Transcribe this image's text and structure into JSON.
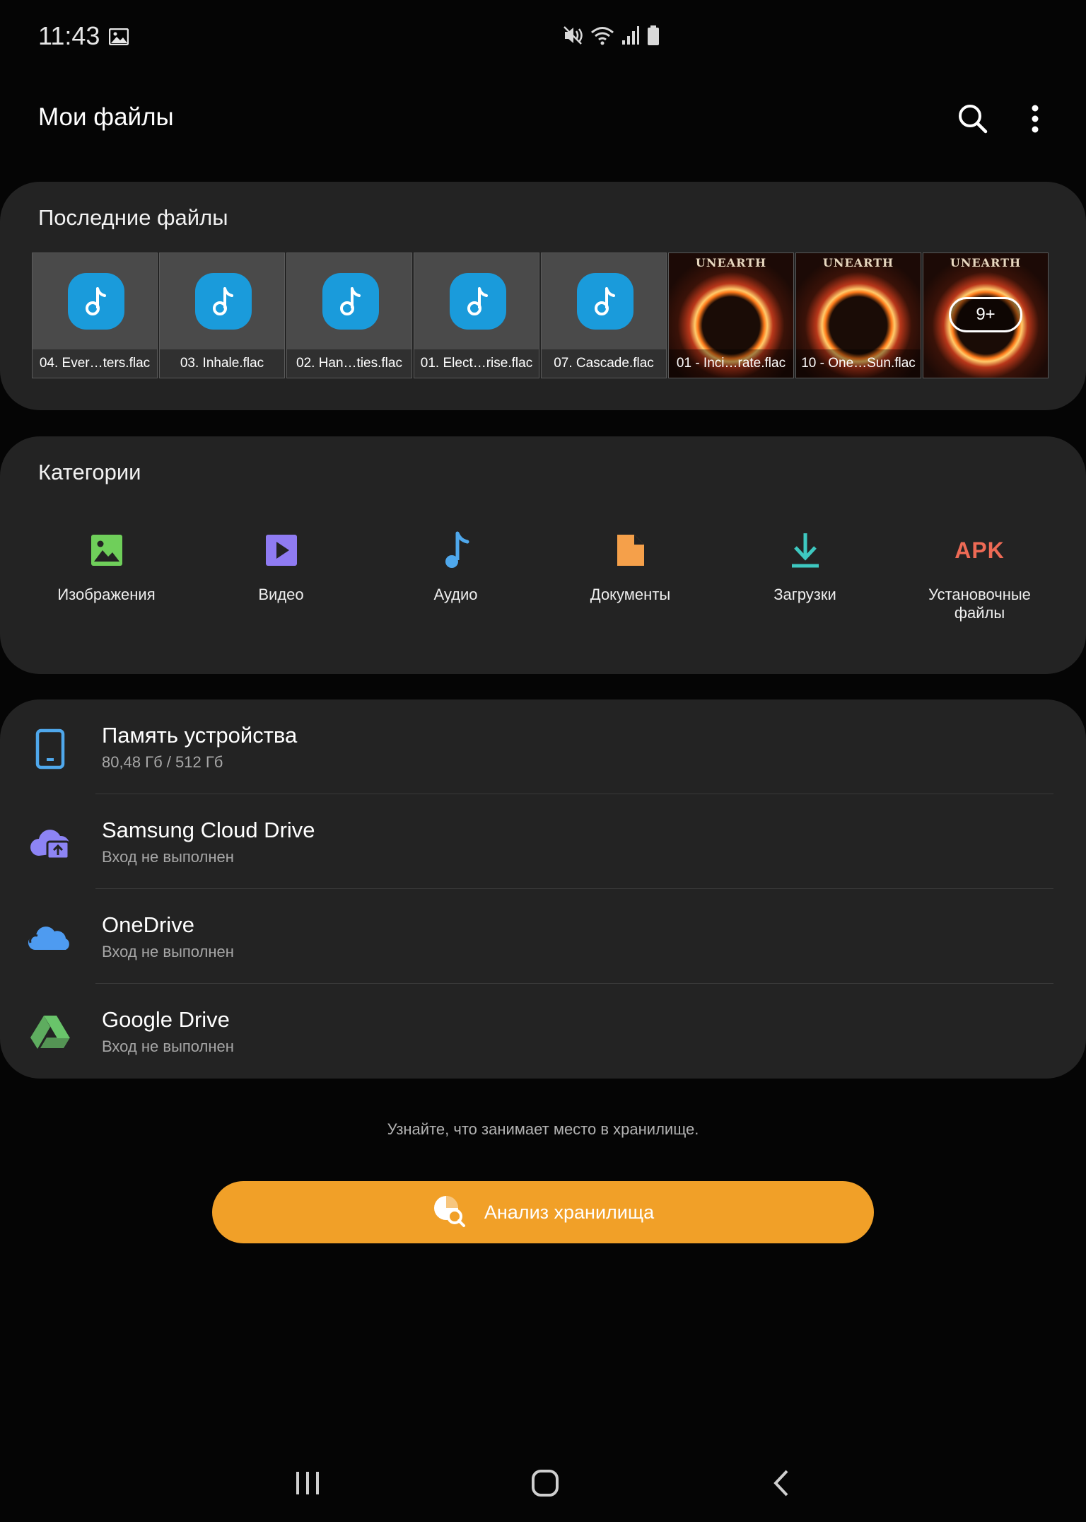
{
  "status_bar": {
    "time": "11:43",
    "icons": [
      "image-icon",
      "mute-icon",
      "wifi-icon",
      "signal-icon",
      "battery-icon"
    ]
  },
  "header": {
    "title": "Мои файлы",
    "actions": [
      "search-icon",
      "more-options-icon"
    ]
  },
  "recent": {
    "title": "Последние файлы",
    "files": [
      {
        "label": "04. Ever…ters.flac",
        "kind": "audio"
      },
      {
        "label": "03. Inhale.flac",
        "kind": "audio"
      },
      {
        "label": "02. Han…ties.flac",
        "kind": "audio"
      },
      {
        "label": "01. Elect…rise.flac",
        "kind": "audio"
      },
      {
        "label": "07. Cascade.flac",
        "kind": "audio"
      },
      {
        "label": "01 - Inci…rate.flac",
        "kind": "album"
      },
      {
        "label": "10 - One…Sun.flac",
        "kind": "album"
      }
    ],
    "album_logo": "UNEARTH",
    "more_label": "9+"
  },
  "categories": {
    "title": "Категории",
    "items": [
      {
        "label": "Изображения",
        "icon": "image-icon",
        "color": "#6fcf5a"
      },
      {
        "label": "Видео",
        "icon": "video-icon",
        "color": "#8f7bf2"
      },
      {
        "label": "Аудио",
        "icon": "audio-icon",
        "color": "#4fa8ec"
      },
      {
        "label": "Документы",
        "icon": "document-icon",
        "color": "#f5a04a"
      },
      {
        "label": "Загрузки",
        "icon": "download-icon",
        "color": "#3ec8c0"
      },
      {
        "label": "Установочные файлы",
        "icon": "apk-icon",
        "color": "#ee6a55",
        "glyph": "APK"
      }
    ]
  },
  "storage": {
    "items": [
      {
        "name": "Память устройства",
        "sub": "80,48 Гб / 512 Гб",
        "icon": "phone-icon",
        "color": "#4fa8ec"
      },
      {
        "name": "Samsung Cloud Drive",
        "sub": "Вход не выполнен",
        "icon": "samsung-cloud-icon",
        "color": "#8d84f5"
      },
      {
        "name": "OneDrive",
        "sub": "Вход не выполнен",
        "icon": "onedrive-icon",
        "color": "#4e9bf0"
      },
      {
        "name": "Google Drive",
        "sub": "Вход не выполнен",
        "icon": "google-drive-icon",
        "color": "#69c46a"
      }
    ]
  },
  "analyze": {
    "hint": "Узнайте, что занимает место в хранилище.",
    "button_label": "Анализ хранилища",
    "color": "#f1a028"
  },
  "nav_bar": {
    "buttons": [
      "recents-icon",
      "home-icon",
      "back-icon"
    ]
  }
}
